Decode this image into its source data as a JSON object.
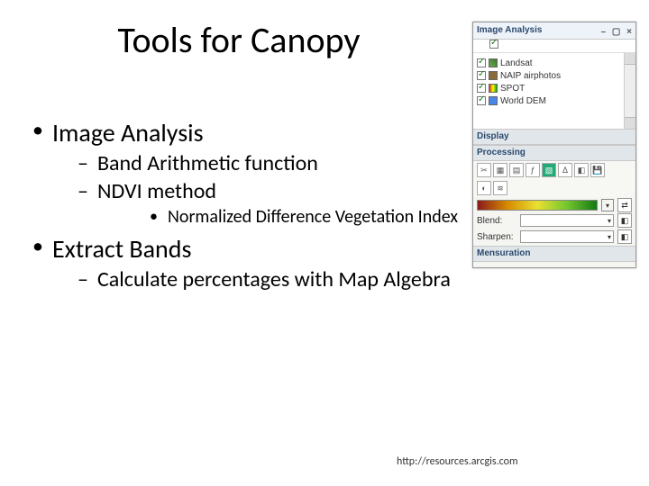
{
  "title": "Tools for Canopy",
  "bullets": {
    "b1": "Image Analysis",
    "b1_1": "Band Arithmetic function",
    "b1_2": "NDVI method",
    "b1_2_1": "Normalized Difference Vegetation Index",
    "b2": "Extract Bands",
    "b2_1": "Calculate percentages with Map Algebra"
  },
  "source": "http://resources.arcgis.com",
  "panel": {
    "title": "Image Analysis",
    "layers": {
      "l1": "Landsat",
      "l2": "NAIP airphotos",
      "l3": "SPOT",
      "l4": "World DEM"
    },
    "sections": {
      "display": "Display",
      "processing": "Processing",
      "mensuration": "Mensuration"
    },
    "combos": {
      "blend": "Blend:",
      "sharpen": "Sharpen:"
    }
  }
}
